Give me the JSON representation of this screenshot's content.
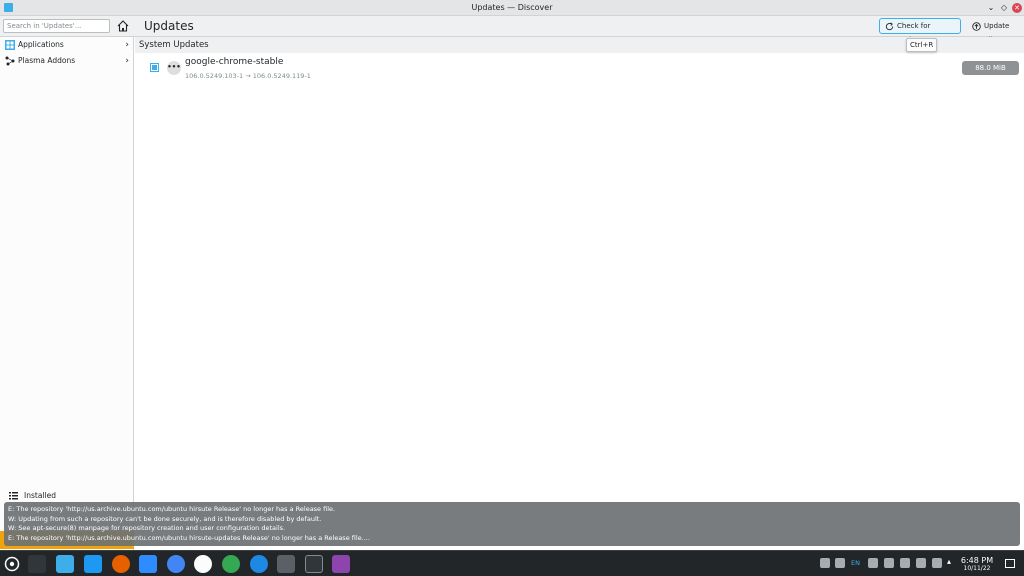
{
  "window": {
    "title": "Updates — Discover"
  },
  "toolbar": {
    "search_placeholder": "Search in 'Updates'...",
    "page_title": "Updates",
    "check_label": "Check for Updates",
    "update_all_label": "Update All",
    "tooltip": "Ctrl+R"
  },
  "sidebar": {
    "items": [
      {
        "label": "Applications"
      },
      {
        "label": "Plasma Addons"
      }
    ],
    "installed_label": "Installed"
  },
  "main": {
    "section_title": "System Updates",
    "updates": [
      {
        "name": "google-chrome-stable",
        "version": "106.0.5249.103-1 → 106.0.5249.119-1",
        "size": "88.0 MiB"
      }
    ]
  },
  "popup": {
    "lines": [
      "E: The repository 'http://us.archive.ubuntu.com/ubuntu hirsute Release' no longer has a Release file.",
      "W: Updating from such a repository can't be done securely, and is therefore disabled by default.",
      "W: See apt-secure(8) manpage for repository creation and user configuration details.",
      "E: The repository 'http://us.archive.ubuntu.com/ubuntu hirsute-updates Release' no longer has a Release file...."
    ]
  },
  "taskbar": {
    "time": "6:48 PM",
    "date": "10/11/22",
    "lang": "EN"
  },
  "colors": {
    "accent": "#3daee9",
    "close": "#da4453",
    "taskbar": "#232629",
    "warning": "#f0a30a"
  }
}
